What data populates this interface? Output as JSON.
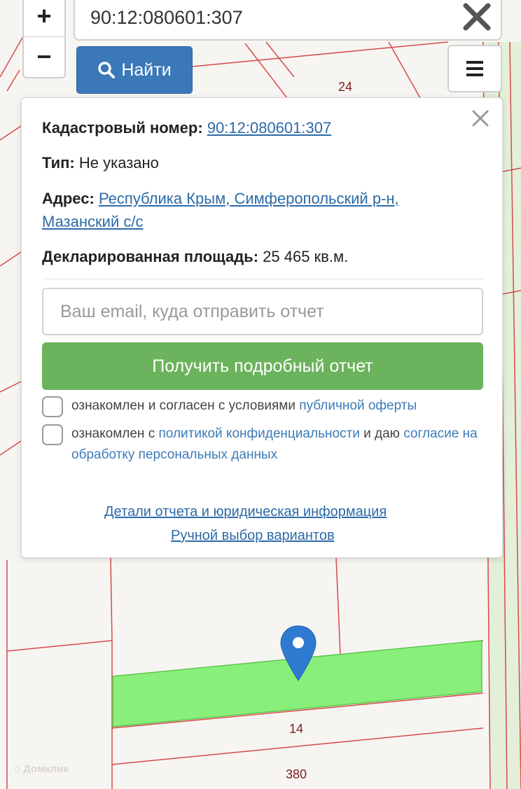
{
  "search": {
    "query": "90:12:080601:307",
    "find_label": "Найти"
  },
  "zoom": {
    "in_label": "+",
    "out_label": "−"
  },
  "map": {
    "parcel_labels": [
      "24",
      "14",
      "380"
    ],
    "watermark": "Домклик",
    "highlight_color": "#88f07a",
    "boundary_color": "#d64a4a"
  },
  "popup": {
    "cadastral_label": "Кадастровый номер:",
    "cadastral_value": "90:12:080601:307",
    "type_label": "Тип:",
    "type_value": "Не указано",
    "address_label": "Адрес:",
    "address_line1": "Республика Крым, Симферопольский р-н,",
    "address_line2": "Мазанский с/с",
    "area_label": "Декларированная площадь:",
    "area_value": "25 465 кв.м.",
    "email_placeholder": "Ваш email, куда отправить отчет",
    "report_button": "Получить подробный отчет",
    "consent1_text": "ознакомлен и согласен с условиями",
    "consent1_link": "публичной оферты",
    "consent2_text_a": "ознакомлен с",
    "consent2_link_a": "политикой конфиденциальности",
    "consent2_text_b": "и даю",
    "consent2_link_b": "согласие на обработку персональных данных",
    "details_link": "Детали отчета и юридическая информация",
    "manual_link": "Ручной выбор вариантов"
  }
}
